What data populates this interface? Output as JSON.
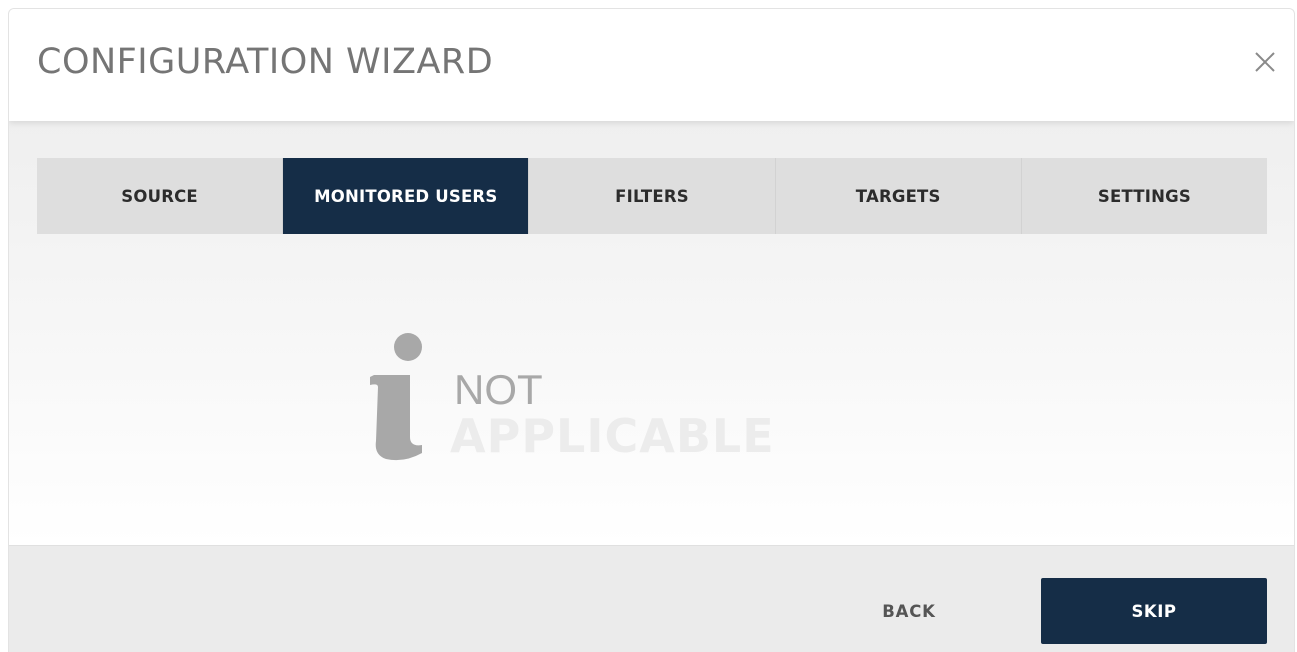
{
  "dialog": {
    "title": "CONFIGURATION WIZARD",
    "close_icon": "close-icon"
  },
  "tabs": [
    {
      "label": "SOURCE",
      "active": false
    },
    {
      "label": "MONITORED USERS",
      "active": true
    },
    {
      "label": "FILTERS",
      "active": false
    },
    {
      "label": "TARGETS",
      "active": false
    },
    {
      "label": "SETTINGS",
      "active": false
    }
  ],
  "content": {
    "icon": "info-icon",
    "message_line1": "NOT",
    "message_line2": "APPLICABLE"
  },
  "footer": {
    "back_label": "BACK",
    "skip_label": "SKIP"
  },
  "colors": {
    "accent": "#152d47",
    "title_text": "#757575",
    "tab_bar": "#dedede",
    "icon_gray": "#a8a8a8"
  }
}
